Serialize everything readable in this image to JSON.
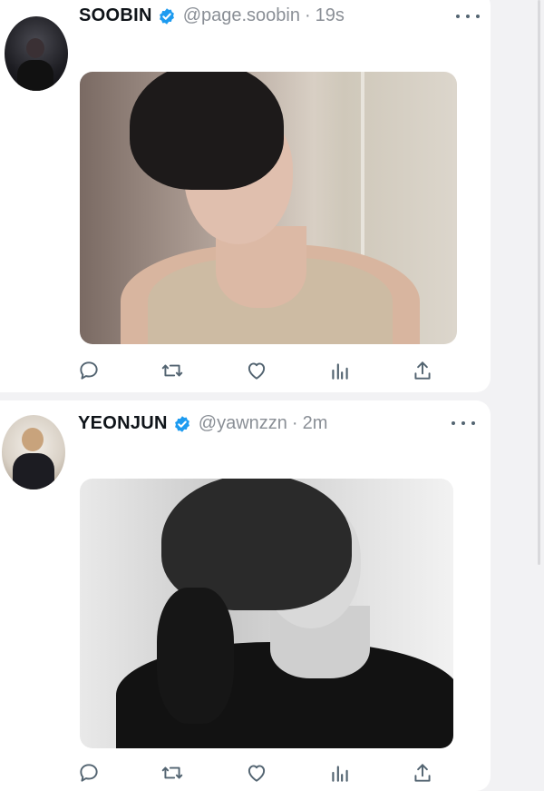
{
  "colors": {
    "verified": "#1d9bf0",
    "name": "#0f1419",
    "meta": "#8a8f96",
    "icons": "#536471"
  },
  "tweets": [
    {
      "display_name": "SOOBIN",
      "handle": "@page.soobin",
      "separator": "·",
      "time": "19s",
      "actions": [
        "reply-icon",
        "retweet-icon",
        "like-icon",
        "views-icon",
        "share-icon"
      ]
    },
    {
      "display_name": "YEONJUN",
      "handle": "@yawnzzn",
      "separator": "·",
      "time": "2m",
      "actions": [
        "reply-icon",
        "retweet-icon",
        "like-icon",
        "views-icon",
        "share-icon"
      ]
    }
  ]
}
